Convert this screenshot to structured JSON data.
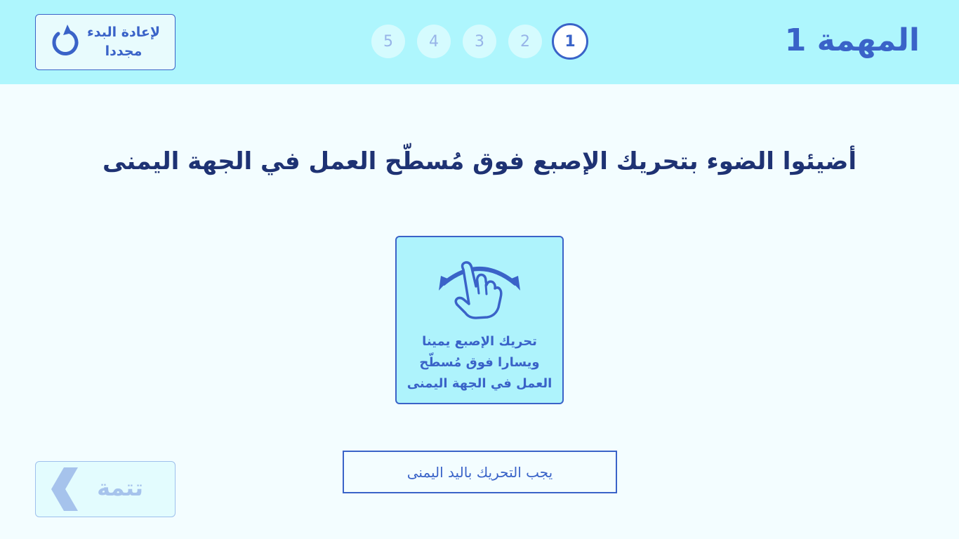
{
  "header": {
    "title": "المهمة 1",
    "restart_label": "لإعادة البدء مجددا"
  },
  "steps": [
    {
      "label": "1",
      "active": true
    },
    {
      "label": "2",
      "active": false
    },
    {
      "label": "3",
      "active": false
    },
    {
      "label": "4",
      "active": false
    },
    {
      "label": "5",
      "active": false
    }
  ],
  "main": {
    "instruction": "أضيئوا الضوء بتحريك الإصبع فوق مُسطّح العمل في الجهة اليمنى",
    "gesture_card": {
      "icon": "swipe-left-right-hand-icon",
      "text": "تحريك الإصبع يمينا ويسارا فوق مُسطّح العمل في الجهة اليمنى"
    },
    "warning": "يجب التحريك باليد اليمنى"
  },
  "footer": {
    "continue_label": "تتمة"
  },
  "colors": {
    "header_bg": "#aef6fd",
    "page_bg": "#f3fdff",
    "accent": "#3a63c8",
    "heading": "#1e3273",
    "disabled": "#a6c3ec"
  }
}
